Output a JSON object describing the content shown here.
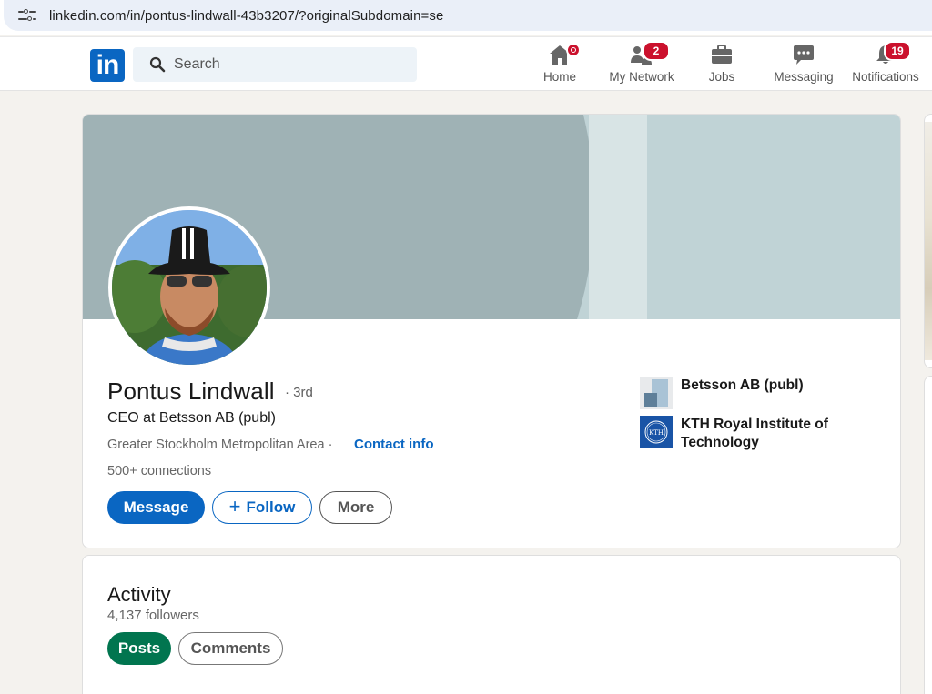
{
  "browser": {
    "url": "linkedin.com/in/pontus-lindwall-43b3207/?originalSubdomain=se"
  },
  "header": {
    "logo_text": "in",
    "search_placeholder": "Search",
    "nav": [
      {
        "label": "Home",
        "icon": "home-icon",
        "badge": ""
      },
      {
        "label": "My Network",
        "icon": "network-icon",
        "badge": "2"
      },
      {
        "label": "Jobs",
        "icon": "briefcase-icon",
        "badge": ""
      },
      {
        "label": "Messaging",
        "icon": "messaging-icon",
        "badge": ""
      },
      {
        "label": "Notifications",
        "icon": "bell-icon",
        "badge": "19"
      }
    ]
  },
  "profile": {
    "name": "Pontus Lindwall",
    "degree": "· 3rd",
    "headline": "CEO at Betsson AB (publ)",
    "location": "Greater Stockholm Metropolitan Area ·",
    "contact_label": "Contact info",
    "connections": "500+ connections",
    "buttons": {
      "message": "Message",
      "follow": "Follow",
      "more": "More"
    },
    "companies": [
      {
        "name": "Betsson AB (publ)",
        "logo": "betsson-logo"
      },
      {
        "name": "KTH Royal Institute of Technology",
        "logo": "kth-logo",
        "logo_text": "KTH"
      }
    ]
  },
  "activity": {
    "title": "Activity",
    "followers": "4,137 followers",
    "tabs": [
      "Posts",
      "Comments"
    ]
  },
  "colors": {
    "brand": "#0a66c2",
    "badge": "#cb112d",
    "posts_pill": "#01754f",
    "banner_light": "#c0d3d6",
    "banner_dark": "#9fb2b5"
  }
}
